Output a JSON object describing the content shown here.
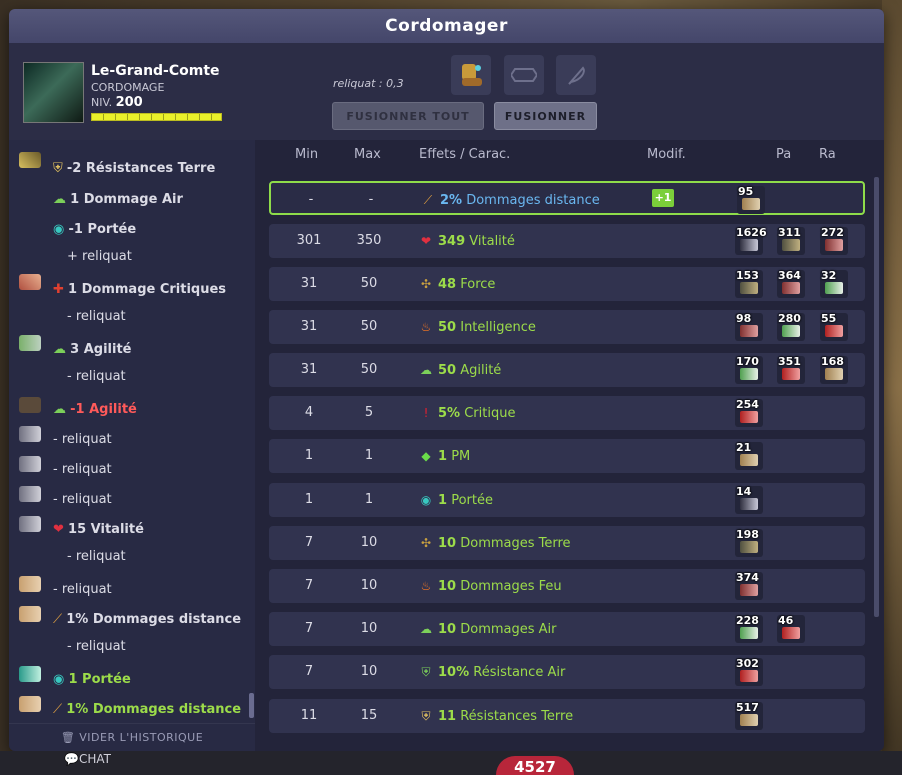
{
  "window": {
    "title": "Cordomager"
  },
  "character": {
    "name": "Le-Grand-Comte",
    "job": "CORDOMAGE",
    "level_label": "NIV.",
    "level": "200"
  },
  "header": {
    "reliquat": "reliquat : 0,3",
    "btn_fuse_all": "FUSIONNER TOUT",
    "btn_fuse": "FUSIONNER"
  },
  "history": {
    "items": [
      "-2 Résistances Terre",
      "1 Dommage Air",
      "-1 Portée",
      "+ reliquat",
      "1 Dommage Critiques",
      "- reliquat",
      "3 Agilité",
      "- reliquat",
      "-1 Agilité",
      "- reliquat",
      "- reliquat",
      "- reliquat",
      "15 Vitalité",
      "- reliquat",
      "- reliquat",
      "1% Dommages distance",
      "- reliquat",
      "1 Portée",
      "1% Dommages distance"
    ],
    "clear_label": "VIDER L'HISTORIQUE"
  },
  "table": {
    "headers": {
      "min": "Min",
      "max": "Max",
      "effects": "Effets / Carac.",
      "modif": "Modif.",
      "pa": "Pa",
      "ra": "Ra"
    },
    "rows": [
      {
        "min": "-",
        "max": "-",
        "value": "2%",
        "stat": "Dommages distance",
        "modif": "+1",
        "runes": [
          "95"
        ]
      },
      {
        "min": "301",
        "max": "350",
        "value": "349",
        "stat": "Vitalité",
        "runes": [
          "1626",
          "311",
          "272"
        ]
      },
      {
        "min": "31",
        "max": "50",
        "value": "48",
        "stat": "Force",
        "runes": [
          "153",
          "364",
          "32"
        ]
      },
      {
        "min": "31",
        "max": "50",
        "value": "50",
        "stat": "Intelligence",
        "runes": [
          "98",
          "280",
          "55"
        ]
      },
      {
        "min": "31",
        "max": "50",
        "value": "50",
        "stat": "Agilité",
        "runes": [
          "170",
          "351",
          "168"
        ]
      },
      {
        "min": "4",
        "max": "5",
        "value": "5%",
        "stat": "Critique",
        "runes": [
          "254"
        ]
      },
      {
        "min": "1",
        "max": "1",
        "value": "1",
        "stat": "PM",
        "runes": [
          "21"
        ]
      },
      {
        "min": "1",
        "max": "1",
        "value": "1",
        "stat": "Portée",
        "runes": [
          "14"
        ]
      },
      {
        "min": "7",
        "max": "10",
        "value": "10",
        "stat": "Dommages Terre",
        "runes": [
          "198"
        ]
      },
      {
        "min": "7",
        "max": "10",
        "value": "10",
        "stat": "Dommages Feu",
        "runes": [
          "374"
        ]
      },
      {
        "min": "7",
        "max": "10",
        "value": "10",
        "stat": "Dommages Air",
        "runes": [
          "228",
          "46"
        ]
      },
      {
        "min": "7",
        "max": "10",
        "value": "10%",
        "stat": "Résistance Air",
        "runes": [
          "302"
        ]
      },
      {
        "min": "11",
        "max": "15",
        "value": "11",
        "stat": "Résistances Terre",
        "runes": [
          "517"
        ]
      }
    ]
  },
  "bottom": {
    "chat": "CHAT",
    "hp": "4527"
  },
  "colors": {
    "accent_green": "#9cdc4a",
    "selected_blue": "#6ab7f0",
    "negative_red": "#ff5a5a"
  }
}
